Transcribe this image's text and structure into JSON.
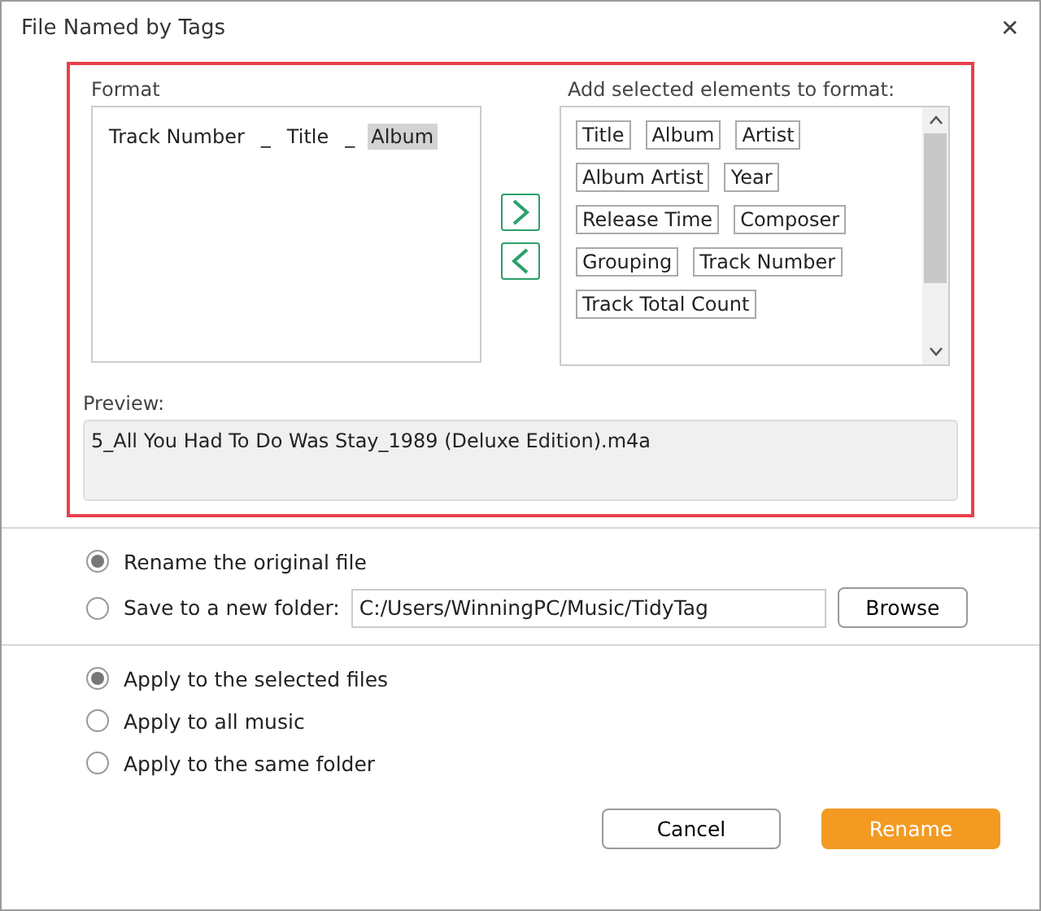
{
  "window": {
    "title": "File Named by Tags",
    "close": "✕"
  },
  "format": {
    "label": "Format",
    "tokens": [
      {
        "text": "Track Number",
        "selected": false
      },
      {
        "text": "_",
        "selected": false
      },
      {
        "text": "Title",
        "selected": false
      },
      {
        "text": "_",
        "selected": false
      },
      {
        "text": "Album",
        "selected": true
      }
    ]
  },
  "elements": {
    "label": "Add selected elements to format:",
    "rows": [
      [
        "Title",
        "Album",
        "Artist"
      ],
      [
        "Album Artist",
        "Year"
      ],
      [
        "Release Time",
        "Composer"
      ],
      [
        "Grouping",
        "Track Number"
      ],
      [
        "Track Total Count"
      ]
    ]
  },
  "preview": {
    "label": "Preview:",
    "value": "5_All You Had To Do Was Stay_1989 (Deluxe Edition).m4a"
  },
  "destination": [
    {
      "label": "Rename the original file",
      "selected": true
    },
    {
      "label": "Save to a new folder:",
      "selected": false
    }
  ],
  "folder": {
    "value": "C:/Users/WinningPC/Music/TidyTag",
    "button": "Browse"
  },
  "scope": [
    {
      "label": "Apply to the selected files",
      "selected": true
    },
    {
      "label": "Apply to all music",
      "selected": false
    },
    {
      "label": "Apply to the same folder",
      "selected": false
    }
  ],
  "buttons": [
    {
      "label": "Cancel",
      "kind": "secondary"
    },
    {
      "label": "Rename",
      "kind": "primary"
    }
  ]
}
